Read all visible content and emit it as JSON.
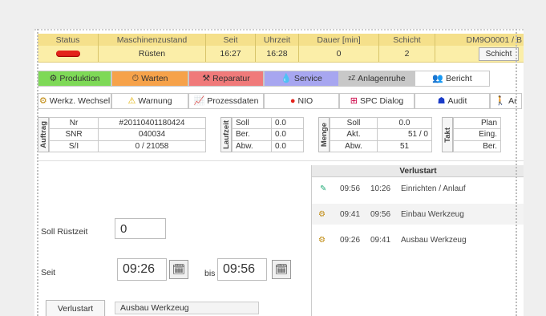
{
  "status_bar": {
    "headers": [
      "Status",
      "Maschinenzustand",
      "Seit",
      "Uhrzeit",
      "Dauer [min]",
      "Schicht",
      "DM9O0001 / B"
    ],
    "values": {
      "zustand": "Rüsten",
      "seit": "16:27",
      "uhrzeit": "16:28",
      "dauer": "0",
      "schicht": "2"
    },
    "schicht_button": "Schicht",
    "colors": {
      "status_led": "#e3231b",
      "header_bg": "#f5e08b",
      "value_bg": "#fbeea8"
    }
  },
  "mode_buttons": [
    {
      "label": "Produktion",
      "icon": "gear-icon",
      "color": "#7ed957"
    },
    {
      "label": "Warten",
      "icon": "clock-icon",
      "color": "#f6a24a"
    },
    {
      "label": "Reparatur",
      "icon": "tools-icon",
      "color": "#f07a7a"
    },
    {
      "label": "Service",
      "icon": "drop-icon",
      "color": "#a7a6f0"
    },
    {
      "label": "Anlagenruhe",
      "icon": "zz-icon",
      "color": "#c8c8c8"
    },
    {
      "label": "Bericht",
      "icon": "people-icon",
      "color": "#ffffff"
    }
  ],
  "tool_buttons": [
    {
      "label": "Werkz. Wechsel",
      "icon": "tool-change-icon"
    },
    {
      "label": "Warnung",
      "icon": "warning-icon"
    },
    {
      "label": "Prozessdaten",
      "icon": "chart-icon"
    },
    {
      "label": "NIO",
      "icon": "red-dot-icon"
    },
    {
      "label": "SPC Dialog",
      "icon": "spc-icon"
    },
    {
      "label": "Audit",
      "icon": "audit-icon"
    },
    {
      "label": "Ar",
      "icon": "figure-icon"
    }
  ],
  "auftrag": {
    "title": "Auftrag",
    "rows": [
      [
        "Nr",
        "#20110401180424"
      ],
      [
        "SNR",
        "040034"
      ],
      [
        "S/I",
        "0 / 21058"
      ]
    ]
  },
  "laufzeit": {
    "title": "Laufzeit",
    "rows": [
      [
        "Soll",
        "0.0"
      ],
      [
        "Ber.",
        "0.0"
      ],
      [
        "Abw.",
        "0.0"
      ]
    ]
  },
  "menge": {
    "title": "Menge",
    "rows": [
      [
        "Soll",
        "0.0"
      ],
      [
        "Akt.",
        "51 / 0"
      ],
      [
        "Abw.",
        "51"
      ]
    ]
  },
  "takt": {
    "title": "Takt",
    "rows": [
      "Plan",
      "Eing.",
      "Ber."
    ]
  },
  "form": {
    "soll_label": "Soll Rüstzeit",
    "soll_value": "0",
    "seit_label": "Seit",
    "seit_value": "09:26",
    "bis_label": "bis",
    "bis_value": "09:56",
    "verlust_button": "Verlustart",
    "verlust_value": "Ausbau Werkzeug"
  },
  "verlust_list": {
    "title": "Verlustart",
    "rows": [
      {
        "icon": "pin-icon",
        "from": "09:56",
        "to": "10:26",
        "text": "Einrichten / Anlauf"
      },
      {
        "icon": "tool-change-icon",
        "from": "09:41",
        "to": "09:56",
        "text": "Einbau Werkzeug"
      },
      {
        "icon": "tool-change-icon",
        "from": "09:26",
        "to": "09:41",
        "text": "Ausbau Werkzeug"
      }
    ]
  }
}
